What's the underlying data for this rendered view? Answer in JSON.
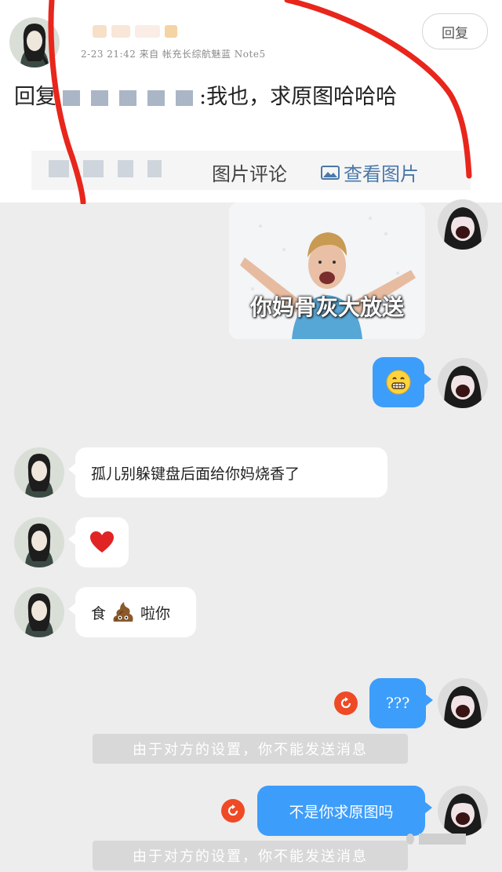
{
  "comment": {
    "meta": "2-23 21:42  来自 帐充长综航魅蓝 Note5",
    "reply_button": "回复",
    "reply_prefix": "回复",
    "reply_suffix": ":我也，求原图哈哈哈",
    "footer_label": "图片评论",
    "footer_link": "查看图片"
  },
  "chat": {
    "sticker_caption": "你妈骨灰大放送",
    "messages": [
      {
        "text": "孤儿别躲键盘后面给你妈烧香了"
      },
      {
        "text": "❤"
      },
      {
        "text_before": "食",
        "text_after": "啦你"
      },
      {
        "text": "???"
      },
      {
        "text": "不是你求原图吗"
      }
    ],
    "notice": "由于对方的设置，你不能发送消息",
    "notice2": "由于对方的设置，你不能发送消息"
  },
  "colors": {
    "bubble_blue": "#3d9dfb",
    "resend_red": "#ef4a25",
    "annotation_red": "#e8261c",
    "link_blue": "#4a78a8"
  },
  "icons": [
    "reply-button",
    "image-icon",
    "grin-emoji-icon",
    "heart-emoji-icon",
    "poop-emoji-icon",
    "resend-icon"
  ]
}
